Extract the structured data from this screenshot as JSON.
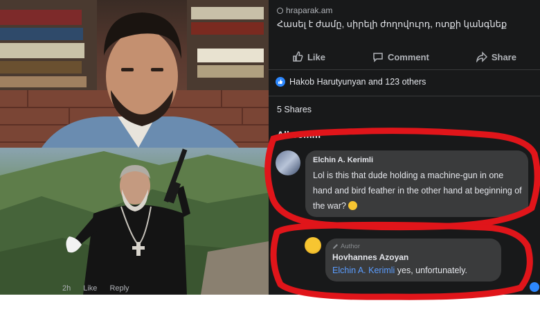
{
  "post": {
    "source": "hraparak.am",
    "headline": "Հասել է ժամը, սիրելի ժողովուրդ, ոտքի կանգնեք",
    "actions": {
      "like_label": "Like",
      "comment_label": "Comment",
      "share_label": "Share"
    },
    "reactions_text": "Hakob Harutyunyan and 123 others",
    "shares_text": "5 Shares",
    "all_comments_label": "All comm"
  },
  "comments": [
    {
      "author": "Elchin A. Kerimli",
      "text": "Lol is this that dude holding a machine-gun in one hand and bird feather in the other hand at beginning of the war?"
    },
    {
      "author_badge": "Author",
      "author": "Hovhannes  Azoyan",
      "mention": "Elchin A. Kerimli",
      "text": " yes, unfortunately.",
      "actions": {
        "age": "2h",
        "like_label": "Like",
        "reply_label": "Reply"
      }
    }
  ],
  "colors": {
    "background": "#18191a",
    "bubble": "#3a3b3c",
    "link": "#5b9dff",
    "annotation": "#e0151a"
  },
  "icons": {
    "source": "globe-icon",
    "like": "thumbs-up-icon",
    "comment": "speech-bubble-icon",
    "share": "share-arrow-icon",
    "reaction": "like-badge-icon",
    "author_badge": "pencil-icon"
  }
}
